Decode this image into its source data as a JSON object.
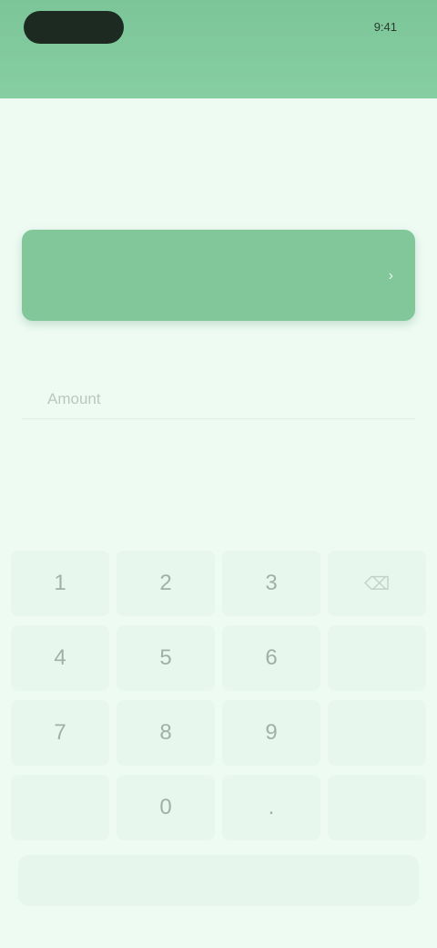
{
  "status_bar": {
    "time": "9:41"
  },
  "header": {
    "caption": ""
  },
  "page": {
    "title": ""
  },
  "balance_card": {
    "label": "",
    "value": "",
    "chevron": "›"
  },
  "amount_field": {
    "value": "",
    "placeholder": "Amount"
  },
  "keypad": {
    "keys": [
      "1",
      "2",
      "3",
      "⌫",
      "4",
      "5",
      "6",
      "",
      "7",
      "8",
      "9",
      "",
      "",
      "0",
      ".",
      ""
    ]
  },
  "confirm_button": {
    "label": ""
  },
  "colors": {
    "accent": "#7cc598",
    "background": "#eefbf3",
    "key_background": "#e8f7ee"
  }
}
